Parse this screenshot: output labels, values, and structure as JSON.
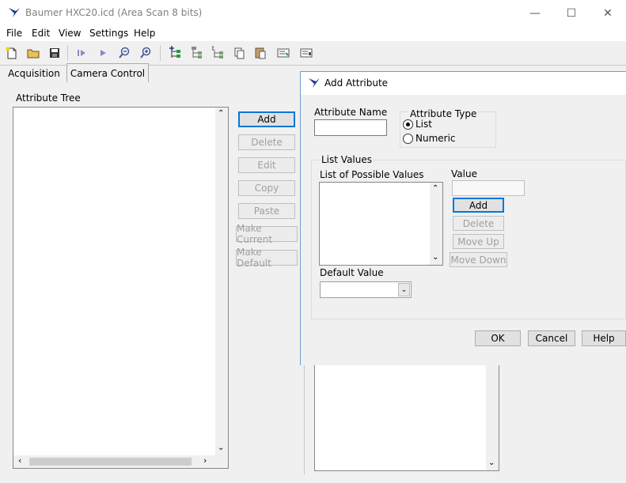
{
  "window": {
    "title": "Baumer HXC20.icd (Area Scan 8 bits)",
    "min": "—",
    "max": "☐",
    "close": "✕"
  },
  "menu": [
    "File",
    "Edit",
    "View",
    "Settings",
    "Help"
  ],
  "toolbar_icons": [
    "new-icon",
    "open-icon",
    "save-icon",
    "step-icon",
    "play-icon",
    "zoom-out-icon",
    "zoom-in-icon",
    "add-attr-icon",
    "delete-attr-icon",
    "edit-attr-icon",
    "copy-attr-icon",
    "paste-attr-icon",
    "make-current-icon",
    "make-default-icon"
  ],
  "tabs": {
    "acquisition": "Acquisition",
    "camera_control": "Camera Control"
  },
  "main": {
    "tree_label": "Attribute Tree",
    "buttons": {
      "add": "Add",
      "delete": "Delete",
      "edit": "Edit",
      "copy": "Copy",
      "paste": "Paste",
      "make_current": "Make Current",
      "make_default": "Make Default"
    }
  },
  "dialog": {
    "title": "Add Attribute",
    "attr_name_label": "Attribute Name",
    "attr_name_value": "",
    "attr_type_label": "Attribute Type",
    "type_list": "List",
    "type_numeric": "Numeric",
    "list_values_label": "List Values",
    "possible_values_label": "List of Possible Values",
    "value_label": "Value",
    "value_input": "",
    "add": "Add",
    "delete": "Delete",
    "move_up": "Move Up",
    "move_down": "Move Down",
    "default_value_label": "Default Value",
    "default_value": "",
    "ok": "OK",
    "cancel": "Cancel",
    "help": "Help"
  },
  "colors": {
    "accent": "#0078d7",
    "icon_blue": "#1e3a8a"
  }
}
